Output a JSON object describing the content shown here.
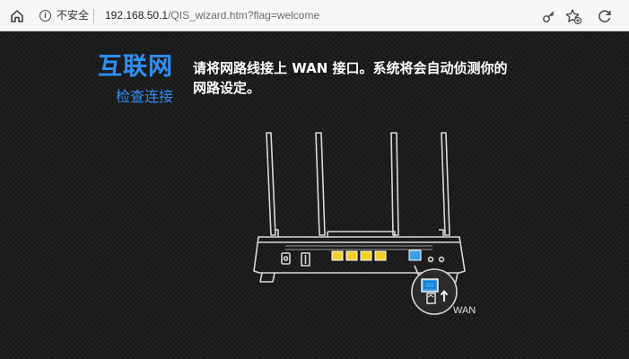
{
  "browser": {
    "security_label": "不安全",
    "security_icon": "info-icon",
    "url_host": "192.168.50.1",
    "url_path": "/QIS_wizard.htm?flag=welcome",
    "toolbar_icons": [
      "home-icon",
      "key-icon",
      "favorite-icon",
      "sync-icon"
    ]
  },
  "wizard": {
    "title": "互联网",
    "subtitle": "检查连接",
    "instruction_line1": "请将网路线接上 WAN 接口。系统将会自动侦测你的",
    "instruction_line2": "网路设定。",
    "port_label": "WAN",
    "accent_color": "#2f8ff5",
    "lan_port_color": "#f3cf2a",
    "wan_port_color": "#3aa0e8"
  }
}
